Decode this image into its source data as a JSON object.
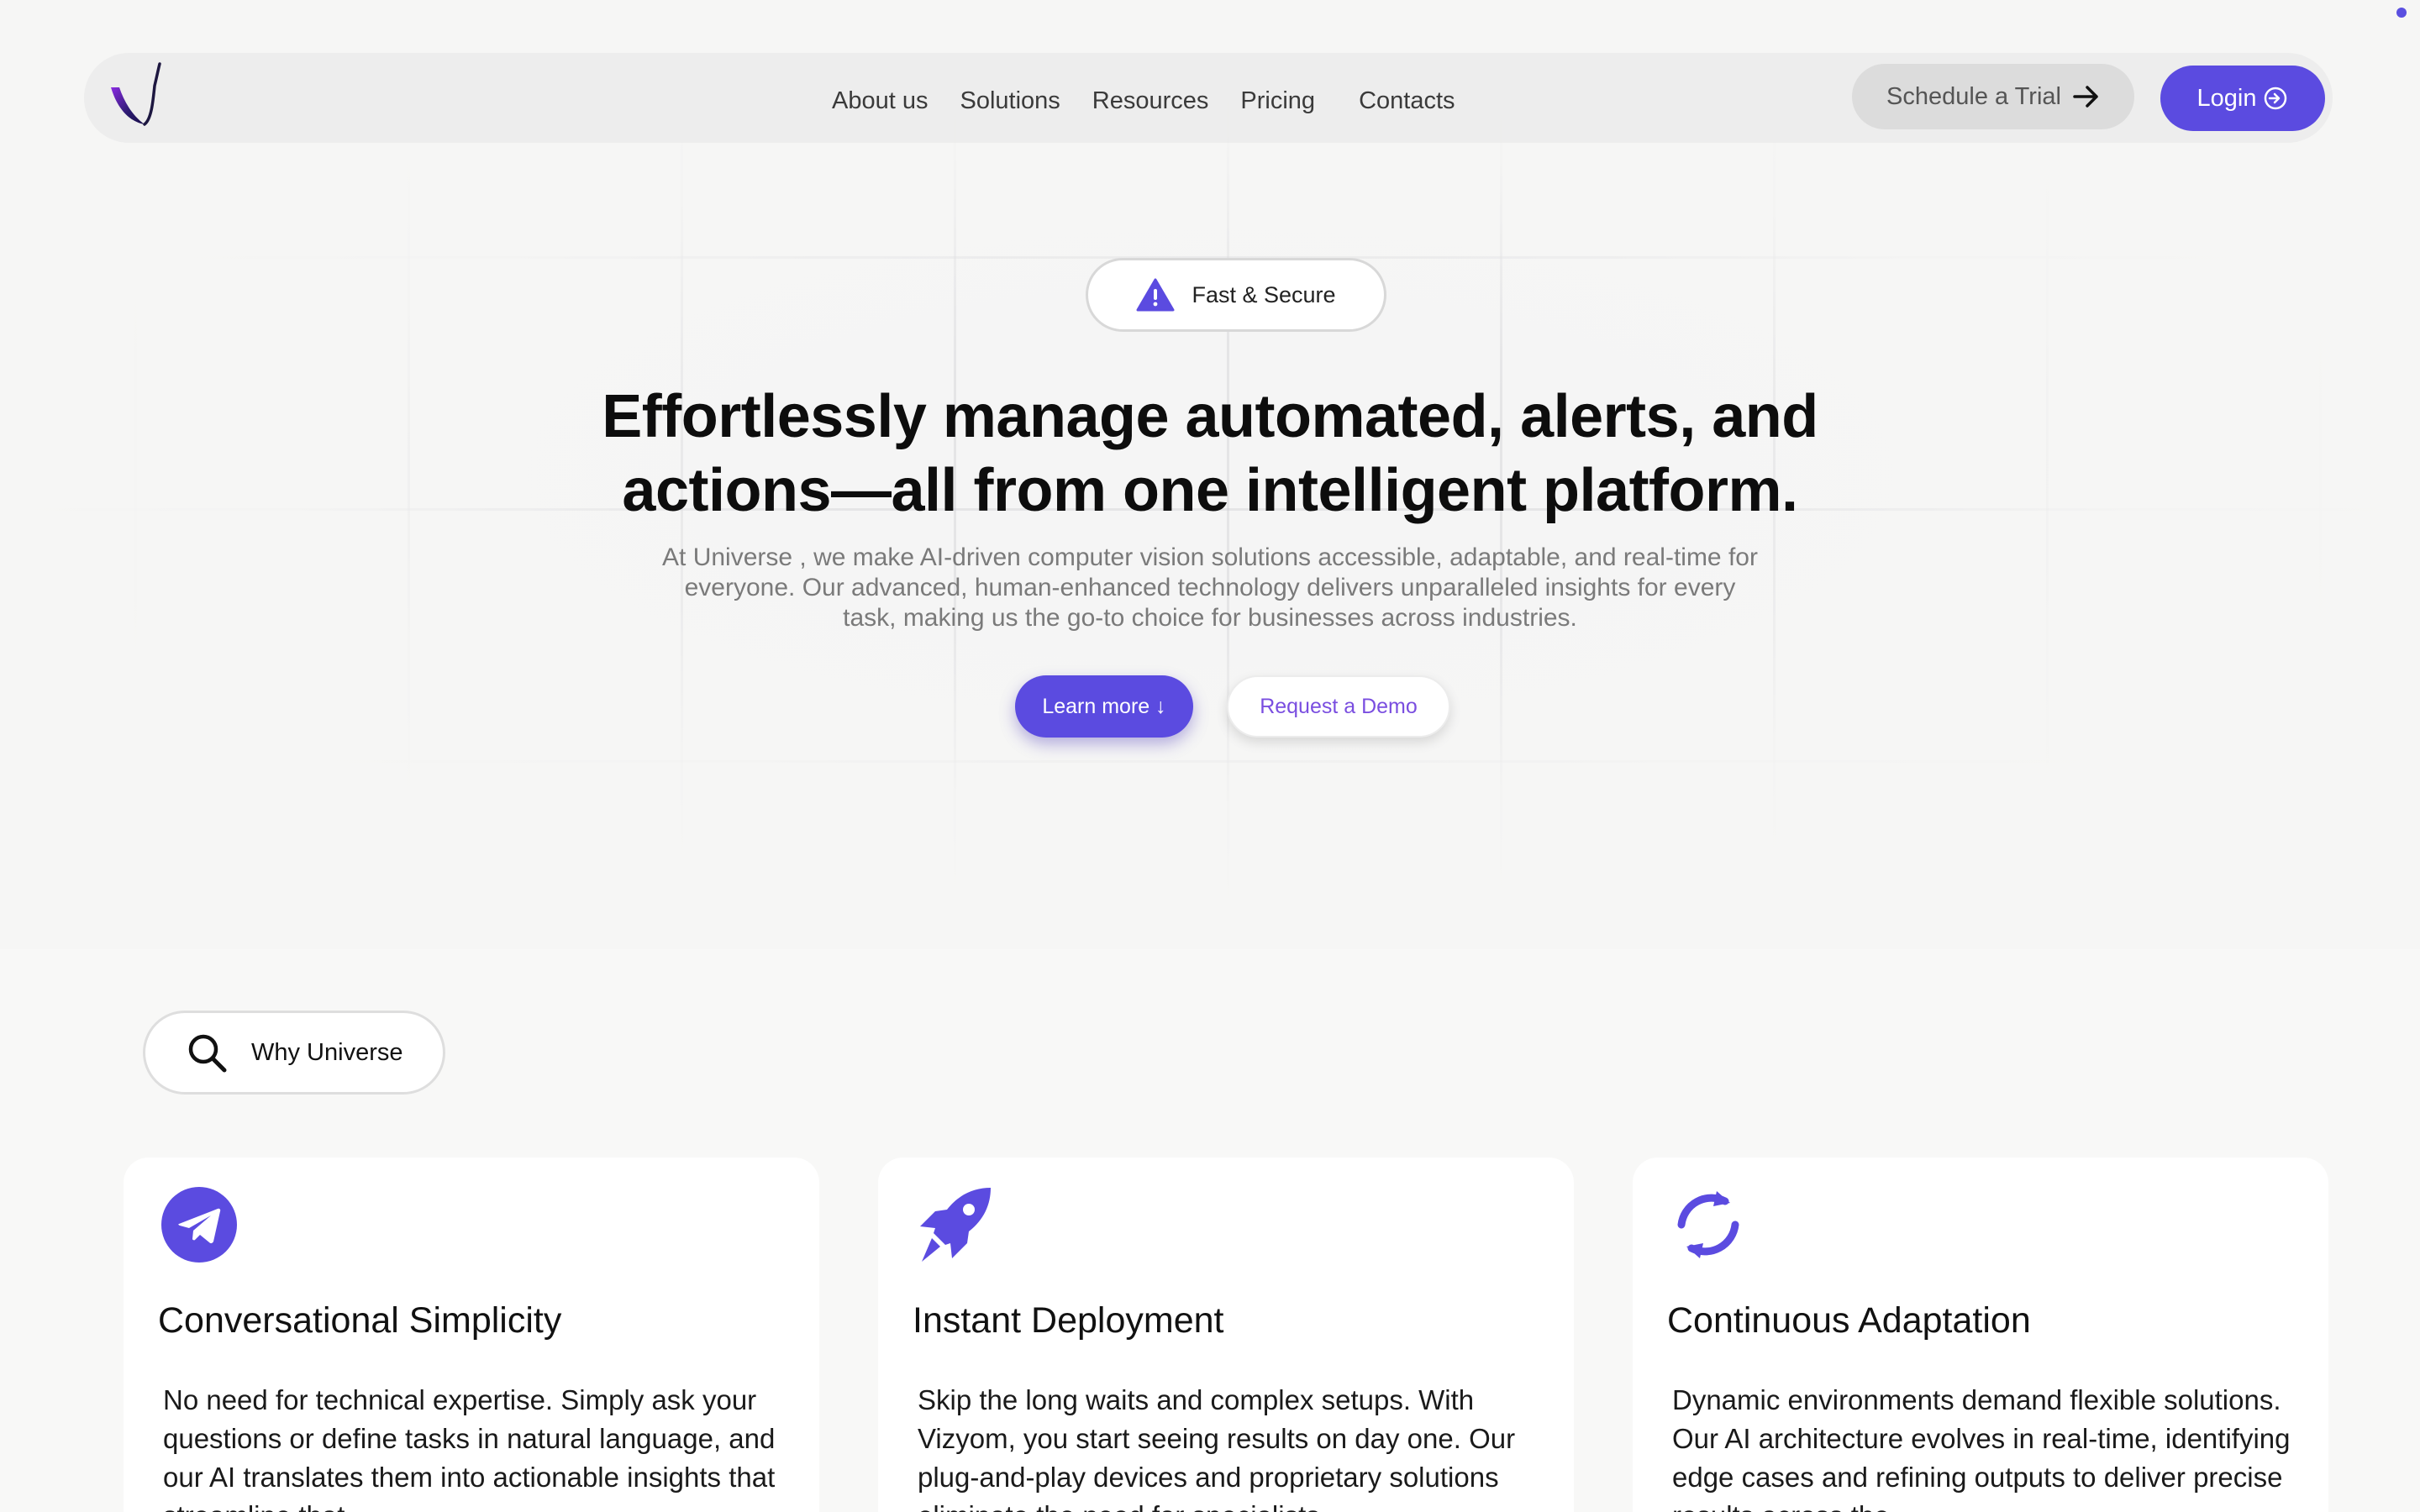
{
  "nav": {
    "links": [
      "About us",
      "Solutions",
      "Resources",
      "Pricing",
      "Contacts"
    ],
    "trial_label": "Schedule a Trial",
    "login_label": "Login"
  },
  "hero": {
    "badge": "Fast & Secure",
    "headline_line1": "Effortlessly manage automated, alerts, and",
    "headline_line2": "actions—all from one intelligent platform.",
    "subtext": "At Universe , we make AI-driven computer vision solutions accessible, adaptable, and real-time for everyone. Our advanced, human-enhanced technology delivers unparalleled insights for every task, making us the go-to choice for businesses across industries.",
    "learn_label": "Learn more ↓",
    "demo_label": "Request a Demo"
  },
  "why": {
    "label": "Why Universe"
  },
  "features": [
    {
      "icon": "telegram-icon",
      "title": "Conversational Simplicity",
      "desc": "No need for technical expertise. Simply ask your questions or define tasks in natural language, and our AI translates them into actionable insights that streamline that"
    },
    {
      "icon": "rocket-icon",
      "title": "Instant Deployment",
      "desc": "Skip the long waits and complex setups. With Vizyom, you start seeing results on day one. Our plug-and-play devices and proprietary solutions eliminate the need for specialists"
    },
    {
      "icon": "sync-icon",
      "title": "Continuous Adaptation",
      "desc": "Dynamic environments demand flexible solutions. Our AI architecture evolves in real-time, identifying edge cases and refining outputs to deliver precise results across the"
    }
  ],
  "colors": {
    "accent": "#5b4be0",
    "demo_text": "#7a4ee0"
  }
}
